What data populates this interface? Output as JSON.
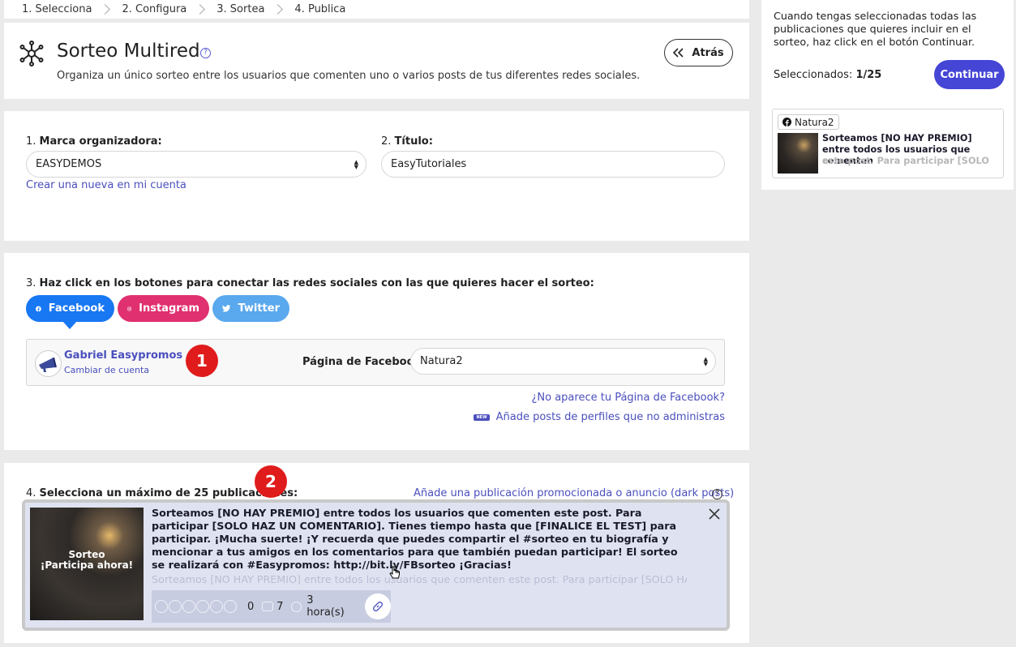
{
  "steps": [
    "1. Selecciona",
    "2. Configura",
    "3. Sortea",
    "4. Publica"
  ],
  "header": {
    "title": "Sorteo Multired",
    "help": "?",
    "subtitle": "Organiza un único sorteo entre los usuarios que comenten uno o varios posts de tus diferentes redes sociales.",
    "back_label": "Atrás"
  },
  "brand": {
    "label_num": "1.",
    "label": "Marca organizadora:",
    "value": "EASYDEMOS",
    "create_link": "Crear una nueva en mi cuenta",
    "title_num": "2.",
    "title_label": "Título:",
    "title_value": "EasyTutoriales"
  },
  "networks": {
    "label_num": "3.",
    "label": "Haz click en los botones para conectar las redes sociales con las que quieres hacer el sorteo:",
    "buttons": [
      {
        "label": "Facebook",
        "color": "#1877f2"
      },
      {
        "label": "Instagram",
        "color": "#e0306f"
      },
      {
        "label": "Twitter",
        "color": "#5aa8ee"
      }
    ],
    "account_name": "Gabriel Easypromos",
    "change_account": "Cambiar de cuenta",
    "badge1": "1",
    "page_label": "Página de Facebook:",
    "page_value": "Natura2",
    "missing_page_link": "¿No aparece tu Página de Facebook?",
    "new_tag": "NEW",
    "add_posts_link": "Añade posts de perfiles que no administras"
  },
  "publications": {
    "label_num": "4.",
    "label": "Selecciona un máximo de 25 publicaciones:",
    "badge2": "2",
    "dark_posts_link": "Añade una publicación promocionada o anuncio (dark posts)",
    "help": "?",
    "post": {
      "image_line1": "Sorteo",
      "image_line2": "¡Participa ahora!",
      "text": "Sorteamos [NO HAY PREMIO] entre todos los usuarios que comenten este post. Para participar [SOLO HAZ UN COMENTARIO]. Tienes tiempo hasta que [FINALICE EL TEST] para participar. ¡Mucha suerte! ¡Y recuerda que puedes compartir el #sorteo en tu biografía y mencionar a tus amigos en los comentarios para que también puedan participar! El sorteo se realizará con #Easypromos: http://bit.ly/FBsorteo ¡Gracias!",
      "faded_text": "Sorteamos [NO HAY PREMIO] entre todos los usuarios que comenten este post. Para participar [SOLO HAZ UN",
      "reactions": "0",
      "comments": "7",
      "time": "3 hora(s)"
    }
  },
  "side": {
    "instructions": "Cuando tengas seleccionadas todas las publicaciones que quieres incluir en el sorteo, haz click en el botón Continuar.",
    "selected_label": "Seleccionados:",
    "selected_count": "1/25",
    "continue_label": "Continuar",
    "mini_page": "Natura2",
    "mini_text": "Sorteamos [NO HAY PREMIO] entre todos los usuarios que comenten",
    "mini_faded": "este post. Para participar [SOLO"
  }
}
